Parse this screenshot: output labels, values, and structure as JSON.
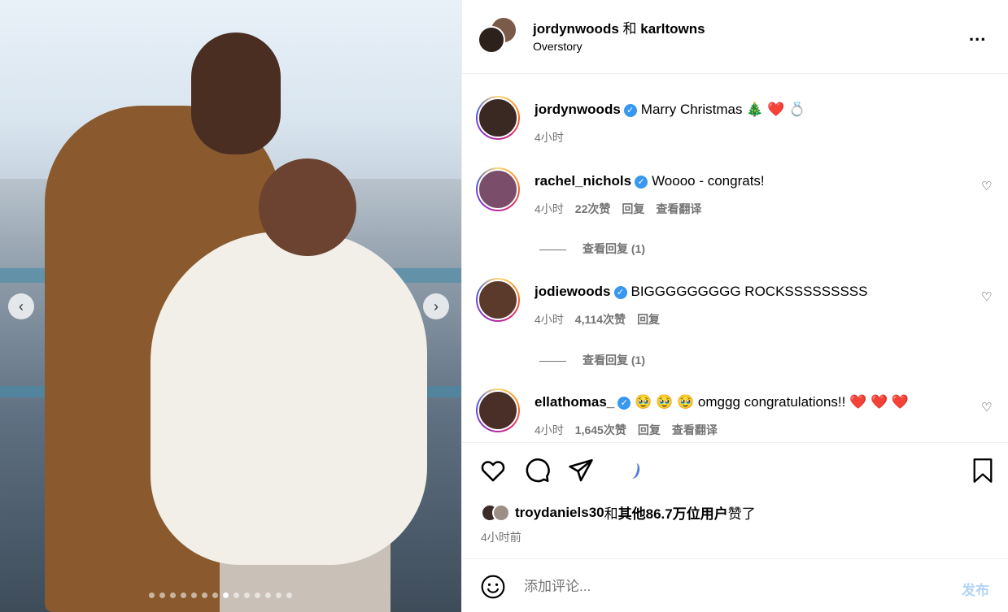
{
  "photo": {
    "total_slides": 14,
    "active_slide": 8
  },
  "header": {
    "user1": "jordynwoods",
    "conjunction": "和",
    "user2": "karltowns",
    "subtitle": "Overstory",
    "more": "..."
  },
  "caption": {
    "user": "jordynwoods",
    "text": "Marry Christmas 🎄 ❤️ 💍",
    "time": "4小时"
  },
  "comments": [
    {
      "user": "rachel_nichols",
      "text": "Woooo - congrats!",
      "time": "4小时",
      "likes": "22次赞",
      "reply": "回复",
      "translate": "查看翻译",
      "view_replies": "查看回复 (1)"
    },
    {
      "user": "jodiewoods",
      "text": "BIGGGGGGGGG ROCKSSSSSSSSS",
      "time": "4小时",
      "likes": "4,114次赞",
      "reply": "回复",
      "view_replies": "查看回复 (1)"
    },
    {
      "user": "ellathomas_",
      "text": "🥹 🥹 🥹 omggg congratulations!! ❤️ ❤️ ❤️",
      "time": "4小时",
      "likes": "1,645次赞",
      "reply": "回复",
      "translate": "查看翻译"
    }
  ],
  "likes_summary": {
    "user": "troydaniels30",
    "conjunction": "和",
    "others": "其他86.7万位用户",
    "suffix": "赞了"
  },
  "post_time": "4小时前",
  "composer": {
    "placeholder": "添加评论...",
    "post_label": "发布"
  },
  "colors": {
    "verified": "#3897f0",
    "post_button": "#b3d3f8",
    "meta_text": "#737373"
  }
}
